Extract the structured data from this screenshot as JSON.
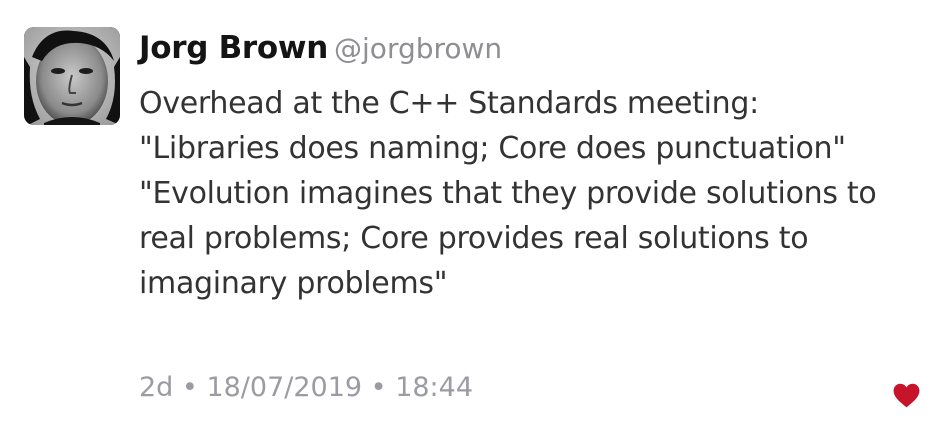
{
  "tweet": {
    "author_name": "Jorg Brown",
    "author_handle": "@jorgbrown",
    "text": "Overhead at the C++ Standards meeting:\n\"Libraries does naming; Core does punctuation\"\n\"Evolution imagines that they provide solutions to real problems; Core provides real solutions to imaginary problems\"",
    "relative_time": "2d",
    "date": "18/07/2019",
    "time": "18:44",
    "separator": "•"
  },
  "icons": {
    "avatar": "profile-photo",
    "like": "heart-icon"
  },
  "colors": {
    "name": "#141414",
    "handle": "#8e8e93",
    "text": "#333333",
    "meta": "#9b9ba4",
    "like": "#c8142b"
  }
}
